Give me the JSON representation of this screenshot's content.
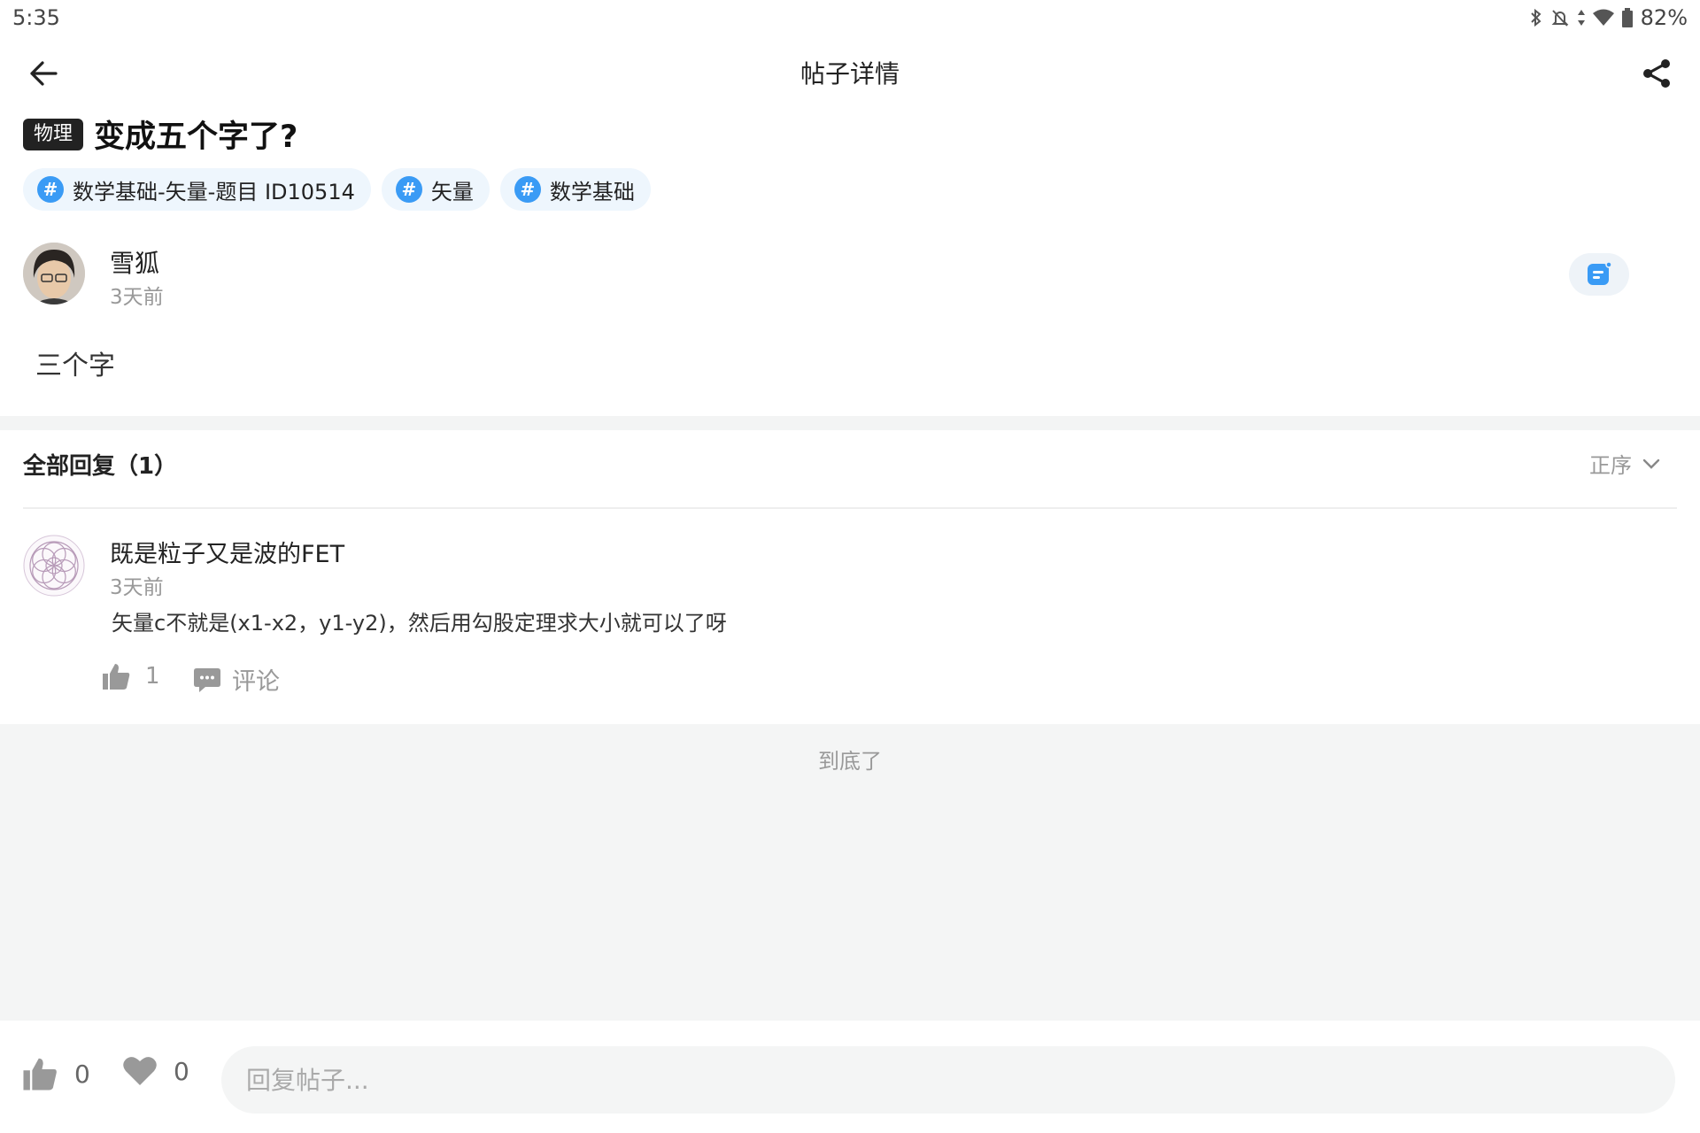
{
  "status_bar": {
    "time": "5:35",
    "battery": "82%"
  },
  "header": {
    "title": "帖子详情"
  },
  "post": {
    "subject": "物理",
    "title": "变成五个字了?",
    "tags": [
      {
        "hash": "#",
        "label": "数学基础-矢量-题目 ID10514"
      },
      {
        "hash": "#",
        "label": "矢量"
      },
      {
        "hash": "#",
        "label": "数学基础"
      }
    ],
    "author": {
      "name": "雪狐",
      "time": "3天前"
    },
    "body": "三个字"
  },
  "replies": {
    "title": "全部回复（1）",
    "sort_label": "正序",
    "items": [
      {
        "name": "既是粒子又是波的FET",
        "time": "3天前",
        "text": "矢量c不就是(x1-x2，y1-y2)，然后用勾股定理求大小就可以了呀",
        "likes": "1",
        "comment_label": "评论"
      }
    ],
    "end_text": "到底了"
  },
  "bottom_bar": {
    "like_count": "0",
    "favorite_count": "0",
    "reply_placeholder": "回复帖子..."
  },
  "colors": {
    "accent": "#3a9bf5",
    "muted": "#999999",
    "band": "#f3f4f4"
  }
}
